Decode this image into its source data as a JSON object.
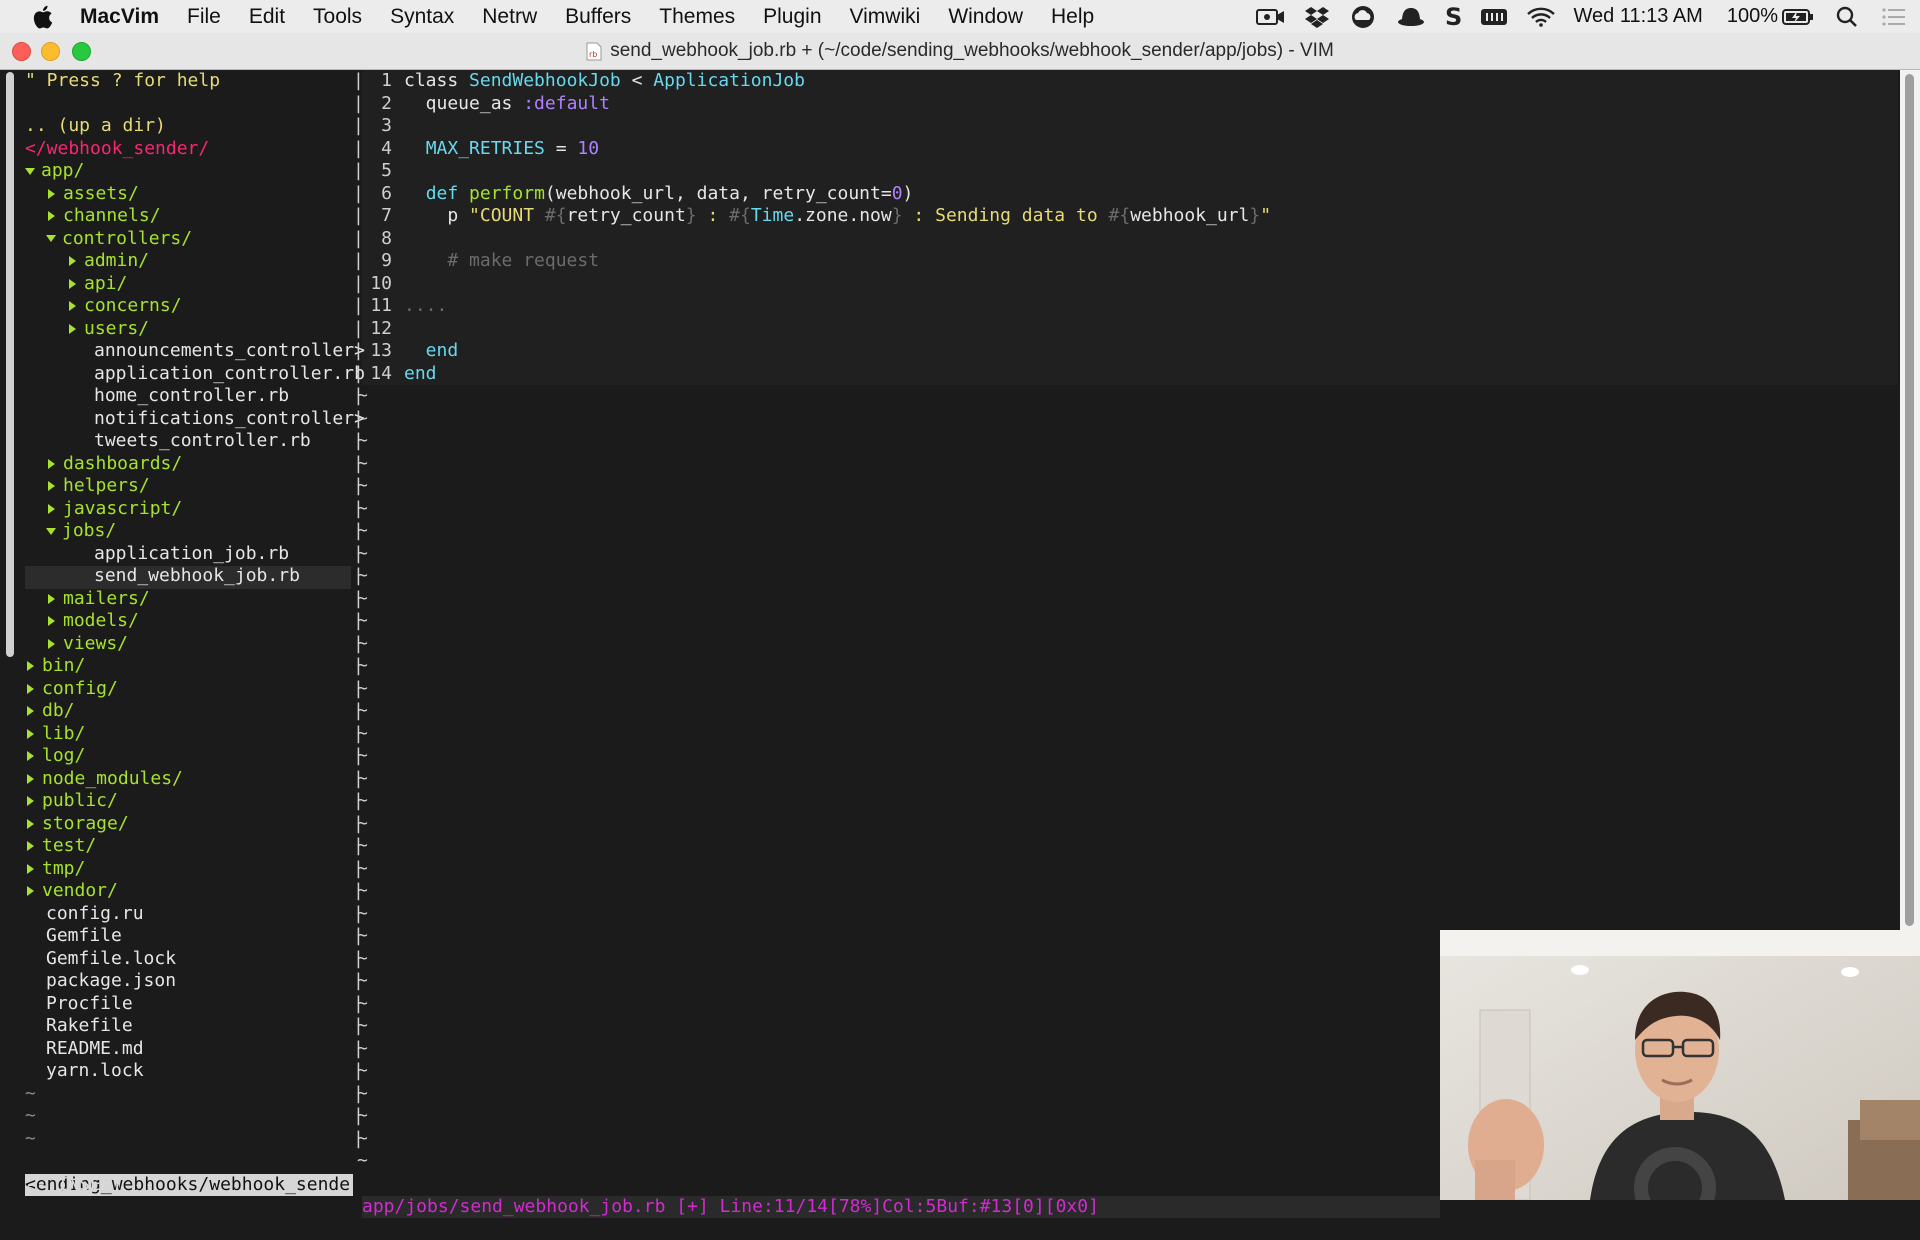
{
  "menubar": {
    "items": [
      "MacVim",
      "File",
      "Edit",
      "Tools",
      "Syntax",
      "Netrw",
      "Buffers",
      "Themes",
      "Plugin",
      "Vimwiki",
      "Window",
      "Help"
    ],
    "clock": "Wed 11:13 AM",
    "battery": "100%"
  },
  "window": {
    "title": "send_webhook_job.rb + (~/code/sending_webhooks/webhook_sender/app/jobs) - VIM"
  },
  "netrw": {
    "help": "\" Press ? for help",
    "updir": ".. (up a dir)",
    "root": "</webhook_sender/",
    "entries": [
      {
        "text": "app/",
        "indent": 0,
        "kind": "dir",
        "open": true
      },
      {
        "text": "assets/",
        "indent": 1,
        "kind": "dir",
        "open": false
      },
      {
        "text": "channels/",
        "indent": 1,
        "kind": "dir",
        "open": false
      },
      {
        "text": "controllers/",
        "indent": 1,
        "kind": "dir",
        "open": true
      },
      {
        "text": "admin/",
        "indent": 2,
        "kind": "dir",
        "open": false
      },
      {
        "text": "api/",
        "indent": 2,
        "kind": "dir",
        "open": false
      },
      {
        "text": "concerns/",
        "indent": 2,
        "kind": "dir",
        "open": false
      },
      {
        "text": "users/",
        "indent": 2,
        "kind": "dir",
        "open": false
      },
      {
        "text": "announcements_controller>",
        "indent": 2,
        "kind": "file"
      },
      {
        "text": "application_controller.rb",
        "indent": 2,
        "kind": "file"
      },
      {
        "text": "home_controller.rb",
        "indent": 2,
        "kind": "file"
      },
      {
        "text": "notifications_controller>",
        "indent": 2,
        "kind": "file"
      },
      {
        "text": "tweets_controller.rb",
        "indent": 2,
        "kind": "file"
      },
      {
        "text": "dashboards/",
        "indent": 1,
        "kind": "dir",
        "open": false
      },
      {
        "text": "helpers/",
        "indent": 1,
        "kind": "dir",
        "open": false
      },
      {
        "text": "javascript/",
        "indent": 1,
        "kind": "dir",
        "open": false
      },
      {
        "text": "jobs/",
        "indent": 1,
        "kind": "dir",
        "open": true
      },
      {
        "text": "application_job.rb",
        "indent": 2,
        "kind": "file"
      },
      {
        "text": "send_webhook_job.rb",
        "indent": 2,
        "kind": "file",
        "selected": true
      },
      {
        "text": "mailers/",
        "indent": 1,
        "kind": "dir",
        "open": false
      },
      {
        "text": "models/",
        "indent": 1,
        "kind": "dir",
        "open": false
      },
      {
        "text": "views/",
        "indent": 1,
        "kind": "dir",
        "open": false
      },
      {
        "text": "bin/",
        "indent": 0,
        "kind": "dir",
        "open": false
      },
      {
        "text": "config/",
        "indent": 0,
        "kind": "dir",
        "open": false
      },
      {
        "text": "db/",
        "indent": 0,
        "kind": "dir",
        "open": false
      },
      {
        "text": "lib/",
        "indent": 0,
        "kind": "dir",
        "open": false
      },
      {
        "text": "log/",
        "indent": 0,
        "kind": "dir",
        "open": false
      },
      {
        "text": "node_modules/",
        "indent": 0,
        "kind": "dir",
        "open": false
      },
      {
        "text": "public/",
        "indent": 0,
        "kind": "dir",
        "open": false
      },
      {
        "text": "storage/",
        "indent": 0,
        "kind": "dir",
        "open": false
      },
      {
        "text": "test/",
        "indent": 0,
        "kind": "dir",
        "open": false
      },
      {
        "text": "tmp/",
        "indent": 0,
        "kind": "dir",
        "open": false
      },
      {
        "text": "vendor/",
        "indent": 0,
        "kind": "dir",
        "open": false
      },
      {
        "text": "config.ru",
        "indent": 0,
        "kind": "rootfile"
      },
      {
        "text": "Gemfile",
        "indent": 0,
        "kind": "rootfile"
      },
      {
        "text": "Gemfile.lock",
        "indent": 0,
        "kind": "rootfile"
      },
      {
        "text": "package.json",
        "indent": 0,
        "kind": "rootfile"
      },
      {
        "text": "Procfile",
        "indent": 0,
        "kind": "rootfile"
      },
      {
        "text": "Rakefile",
        "indent": 0,
        "kind": "rootfile"
      },
      {
        "text": "README.md",
        "indent": 0,
        "kind": "rootfile"
      },
      {
        "text": "yarn.lock",
        "indent": 0,
        "kind": "rootfile"
      }
    ],
    "trailing_tildes": 3
  },
  "editor": {
    "lines": [
      [
        [
          "class ",
          "white"
        ],
        [
          "SendWebhookJob",
          "cyan"
        ],
        [
          " < ",
          "white"
        ],
        [
          "ApplicationJob",
          "cyan"
        ]
      ],
      [
        [
          "  queue_as ",
          "white"
        ],
        [
          ":default",
          "purple"
        ]
      ],
      [],
      [
        [
          "  ",
          "white"
        ],
        [
          "MAX_RETRIES",
          "cyan"
        ],
        [
          " = ",
          "white"
        ],
        [
          "10",
          "purple"
        ]
      ],
      [],
      [
        [
          "  ",
          "white"
        ],
        [
          "def ",
          "cyan"
        ],
        [
          "perform",
          "green"
        ],
        [
          "(webhook_url, data, retry_count=",
          "white"
        ],
        [
          "0",
          "purple"
        ],
        [
          ")",
          "white"
        ]
      ],
      [
        [
          "    p ",
          "white"
        ],
        [
          "\"COUNT ",
          "yellow"
        ],
        [
          "#{",
          "gray"
        ],
        [
          "retry_count",
          "white"
        ],
        [
          "}",
          "gray"
        ],
        [
          " : ",
          "yellow"
        ],
        [
          "#{",
          "gray"
        ],
        [
          "Time",
          "cyan"
        ],
        [
          ".zone.now",
          "white"
        ],
        [
          "}",
          "gray"
        ],
        [
          " : Sending data to ",
          "yellow"
        ],
        [
          "#{",
          "gray"
        ],
        [
          "webhook_url",
          "white"
        ],
        [
          "}",
          "gray"
        ],
        [
          "\"",
          "yellow"
        ]
      ],
      [],
      [
        [
          "    # make request",
          "gray"
        ]
      ],
      [],
      [
        [
          "....",
          "gray"
        ]
      ],
      [],
      [
        [
          "  end",
          "cyan"
        ]
      ],
      [
        [
          "end",
          "cyan"
        ]
      ]
    ],
    "tilde_count": 35
  },
  "statusline": {
    "left": "<ending_webhooks/webhook_sender ",
    "right": "app/jobs/send_webhook_job.rb [+] Line:11/14[78%]Col:5Buf:#13[0][0x0]"
  },
  "mode": "-- INSERT --",
  "colors": {
    "green": "#a6e22e",
    "white": "#e6e6e6",
    "pink": "#f92672",
    "cyan": "#66d9ef",
    "purple": "#ae81ff",
    "yellow": "#e6db74",
    "gray": "#6b6b6b"
  }
}
